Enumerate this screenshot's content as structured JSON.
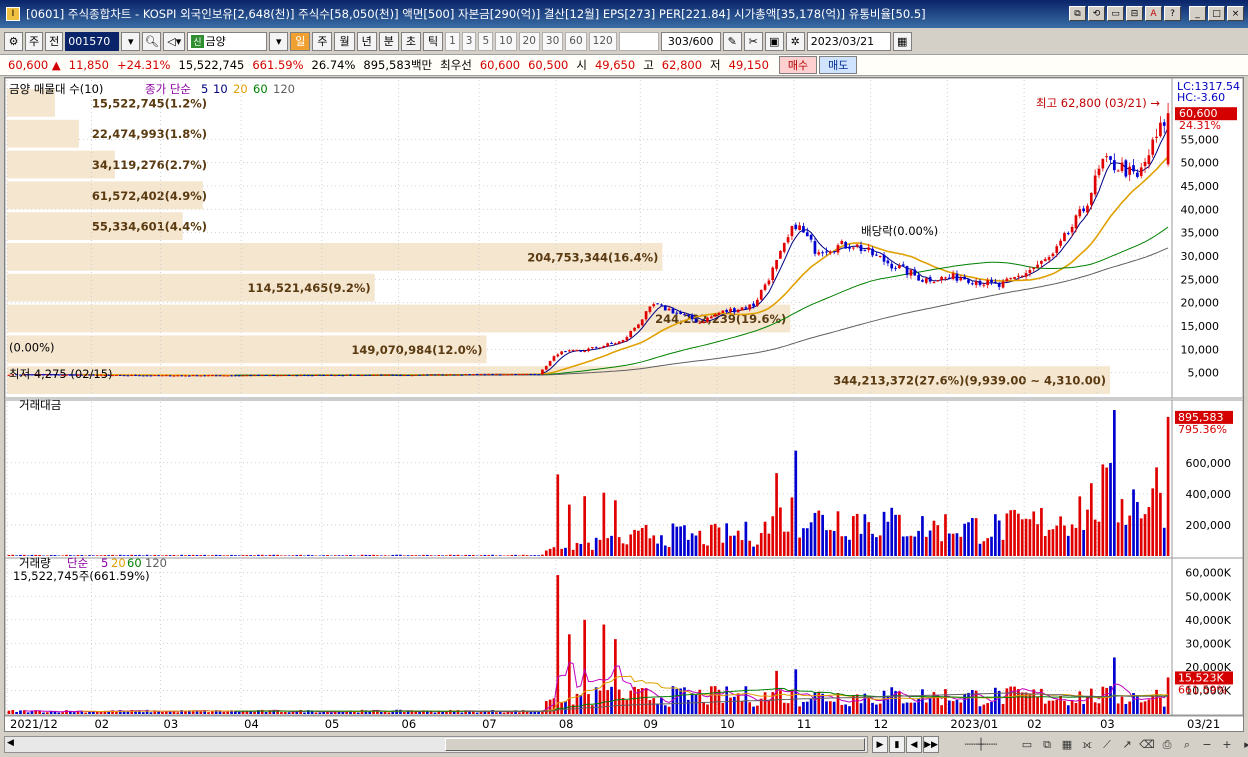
{
  "window": {
    "title": "[0601] 주식종합차트 - KOSPI 외국인보유[2,648(천)] 주식수[58,050(천)] 액면[500] 자본금[290(억)] 결산[12월] EPS[273] PER[221.84] 시가총액[35,178(억)] 유통비율[50.5]",
    "buttons": [
      "⧉",
      "⟲",
      "▭",
      "⊟",
      "A",
      "?",
      "_",
      "□",
      "×"
    ]
  },
  "toolbar": {
    "market": "주",
    "prev": "전",
    "code": "001570",
    "name": "금양",
    "name_badge": "신",
    "periods": [
      "일",
      "주",
      "월",
      "년",
      "분",
      "초",
      "틱"
    ],
    "active_period": "일",
    "intervals": [
      "1",
      "3",
      "5",
      "10",
      "20",
      "30",
      "60",
      "120"
    ],
    "count": "303/600",
    "date": "2023/03/21"
  },
  "quote": {
    "price": "60,600 ▲",
    "change": "11,850",
    "change_pct": "+24.31%",
    "volume": "15,522,745",
    "vol_pct": "661.59%",
    "turnover": "26.74%",
    "amount": "895,583백만",
    "best_label": "최우선",
    "ask": "60,600",
    "bid": "60,500",
    "open_label": "시",
    "open": "49,650",
    "high_label": "고",
    "high": "62,800",
    "low_label": "저",
    "low": "49,150",
    "buy_label": "매수",
    "sell_label": "매도"
  },
  "colors": {
    "up": "#e00000",
    "down": "#0000d0",
    "ma5": "#000080",
    "ma20": "#e0a000",
    "ma60": "#008000",
    "ma120": "#606060",
    "profile": "#f5e6d0",
    "grid": "#cfcfcf"
  },
  "panels": {
    "price": {
      "legend": [
        "금양 매물대 수(10)",
        "종가 단순",
        "5",
        "10",
        "20",
        "60",
        "120"
      ],
      "lc_label": "LC:1317.54",
      "hc_label": "HC:-3.60",
      "yticks": [
        5000,
        10000,
        15000,
        20000,
        25000,
        30000,
        35000,
        40000,
        45000,
        50000,
        55000
      ],
      "ytick_labels": [
        "5,000",
        "10,000",
        "15,000",
        "20,000",
        "25,000",
        "30,000",
        "35,000",
        "40,000",
        "45,000",
        "50,000",
        "55,000"
      ],
      "ylim": [
        0,
        66000
      ],
      "last_price_label": "60,600",
      "last_pct_label": "24.31%",
      "high_label": "최고 62,800 (03/21) →",
      "low_label": "최저 4,275 (02/15)",
      "dividend_label": "배당락(0.00%)",
      "zero_label": "(0.00%)",
      "profile": [
        {
          "volume": 15522745,
          "label": "15,522,745(1.2%)",
          "share": 0.012
        },
        {
          "volume": 22474993,
          "label": "22,474,993(1.8%)",
          "share": 0.018
        },
        {
          "volume": 34119276,
          "label": "34,119,276(2.7%)",
          "share": 0.027
        },
        {
          "volume": 61572402,
          "label": "61,572,402(4.9%)",
          "share": 0.049
        },
        {
          "volume": 55334601,
          "label": "55,334,601(4.4%)",
          "share": 0.044
        },
        {
          "volume": 204753344,
          "label": "204,753,344(16.4%)",
          "share": 0.164
        },
        {
          "volume": 114521465,
          "label": "114,521,465(9.2%)",
          "share": 0.092
        },
        {
          "volume": 244232239,
          "label": "244,232,239(19.6%)",
          "share": 0.196
        },
        {
          "volume": 149070984,
          "label": "149,070,984(12.0%)",
          "share": 0.12
        },
        {
          "volume": 344213372,
          "label": "344,213,372(27.6%)(9,939.00 ~ 4,310.00)",
          "share": 0.276
        }
      ]
    },
    "amount": {
      "legend": "거래대금",
      "yticks": [
        200000,
        400000,
        600000
      ],
      "ytick_labels": [
        "200,000",
        "400,000",
        "600,000"
      ],
      "ylim": [
        0,
        940000
      ],
      "last_label": "895,583",
      "last_pct_label": "795.36%"
    },
    "volume": {
      "legend": [
        "거래량",
        "단순",
        "5",
        "20",
        "60",
        "120"
      ],
      "last_text": "15,522,745주(661.59%)",
      "yticks": [
        10000,
        20000,
        30000,
        40000,
        50000,
        60000
      ],
      "ytick_labels": [
        "10,000K",
        "20,000K",
        "30,000K",
        "40,000K",
        "50,000K",
        "60,000K"
      ],
      "ylim": [
        0,
        62000
      ],
      "last_label": "15,523K",
      "last_pct_label": "661.59%"
    }
  },
  "xaxis": {
    "labels": [
      "2021/12",
      "02",
      "03",
      "04",
      "05",
      "06",
      "07",
      "08",
      "09",
      "10",
      "11",
      "12",
      "2023/01",
      "02",
      "03"
    ],
    "label_index": [
      0,
      22,
      40,
      61,
      82,
      102,
      123,
      143,
      165,
      185,
      205,
      225,
      245,
      265,
      284
    ],
    "right_label": "03/21"
  },
  "chart_data": {
    "type": "candlestick",
    "keypoints": [
      {
        "i": 0,
        "c": 4600
      },
      {
        "i": 40,
        "c": 4400
      },
      {
        "i": 100,
        "c": 4500
      },
      {
        "i": 138,
        "c": 4700
      },
      {
        "i": 143,
        "c": 9200
      },
      {
        "i": 150,
        "c": 9800
      },
      {
        "i": 160,
        "c": 11800
      },
      {
        "i": 168,
        "c": 19500
      },
      {
        "i": 172,
        "c": 18500
      },
      {
        "i": 180,
        "c": 15800
      },
      {
        "i": 185,
        "c": 17800
      },
      {
        "i": 194,
        "c": 19500
      },
      {
        "i": 200,
        "c": 28500
      },
      {
        "i": 205,
        "c": 37000
      },
      {
        "i": 210,
        "c": 31500
      },
      {
        "i": 220,
        "c": 32500
      },
      {
        "i": 228,
        "c": 29000
      },
      {
        "i": 238,
        "c": 25000
      },
      {
        "i": 248,
        "c": 25500
      },
      {
        "i": 258,
        "c": 23500
      },
      {
        "i": 265,
        "c": 26500
      },
      {
        "i": 272,
        "c": 30000
      },
      {
        "i": 280,
        "c": 40000
      },
      {
        "i": 285,
        "c": 50000
      },
      {
        "i": 290,
        "c": 49000
      },
      {
        "i": 294,
        "c": 46500
      },
      {
        "i": 302,
        "c": 60600
      }
    ],
    "last": {
      "open": 49650,
      "high": 62800,
      "low": 49150,
      "close": 60600,
      "volume": 15522745,
      "amount": 895583
    },
    "count": 303
  }
}
